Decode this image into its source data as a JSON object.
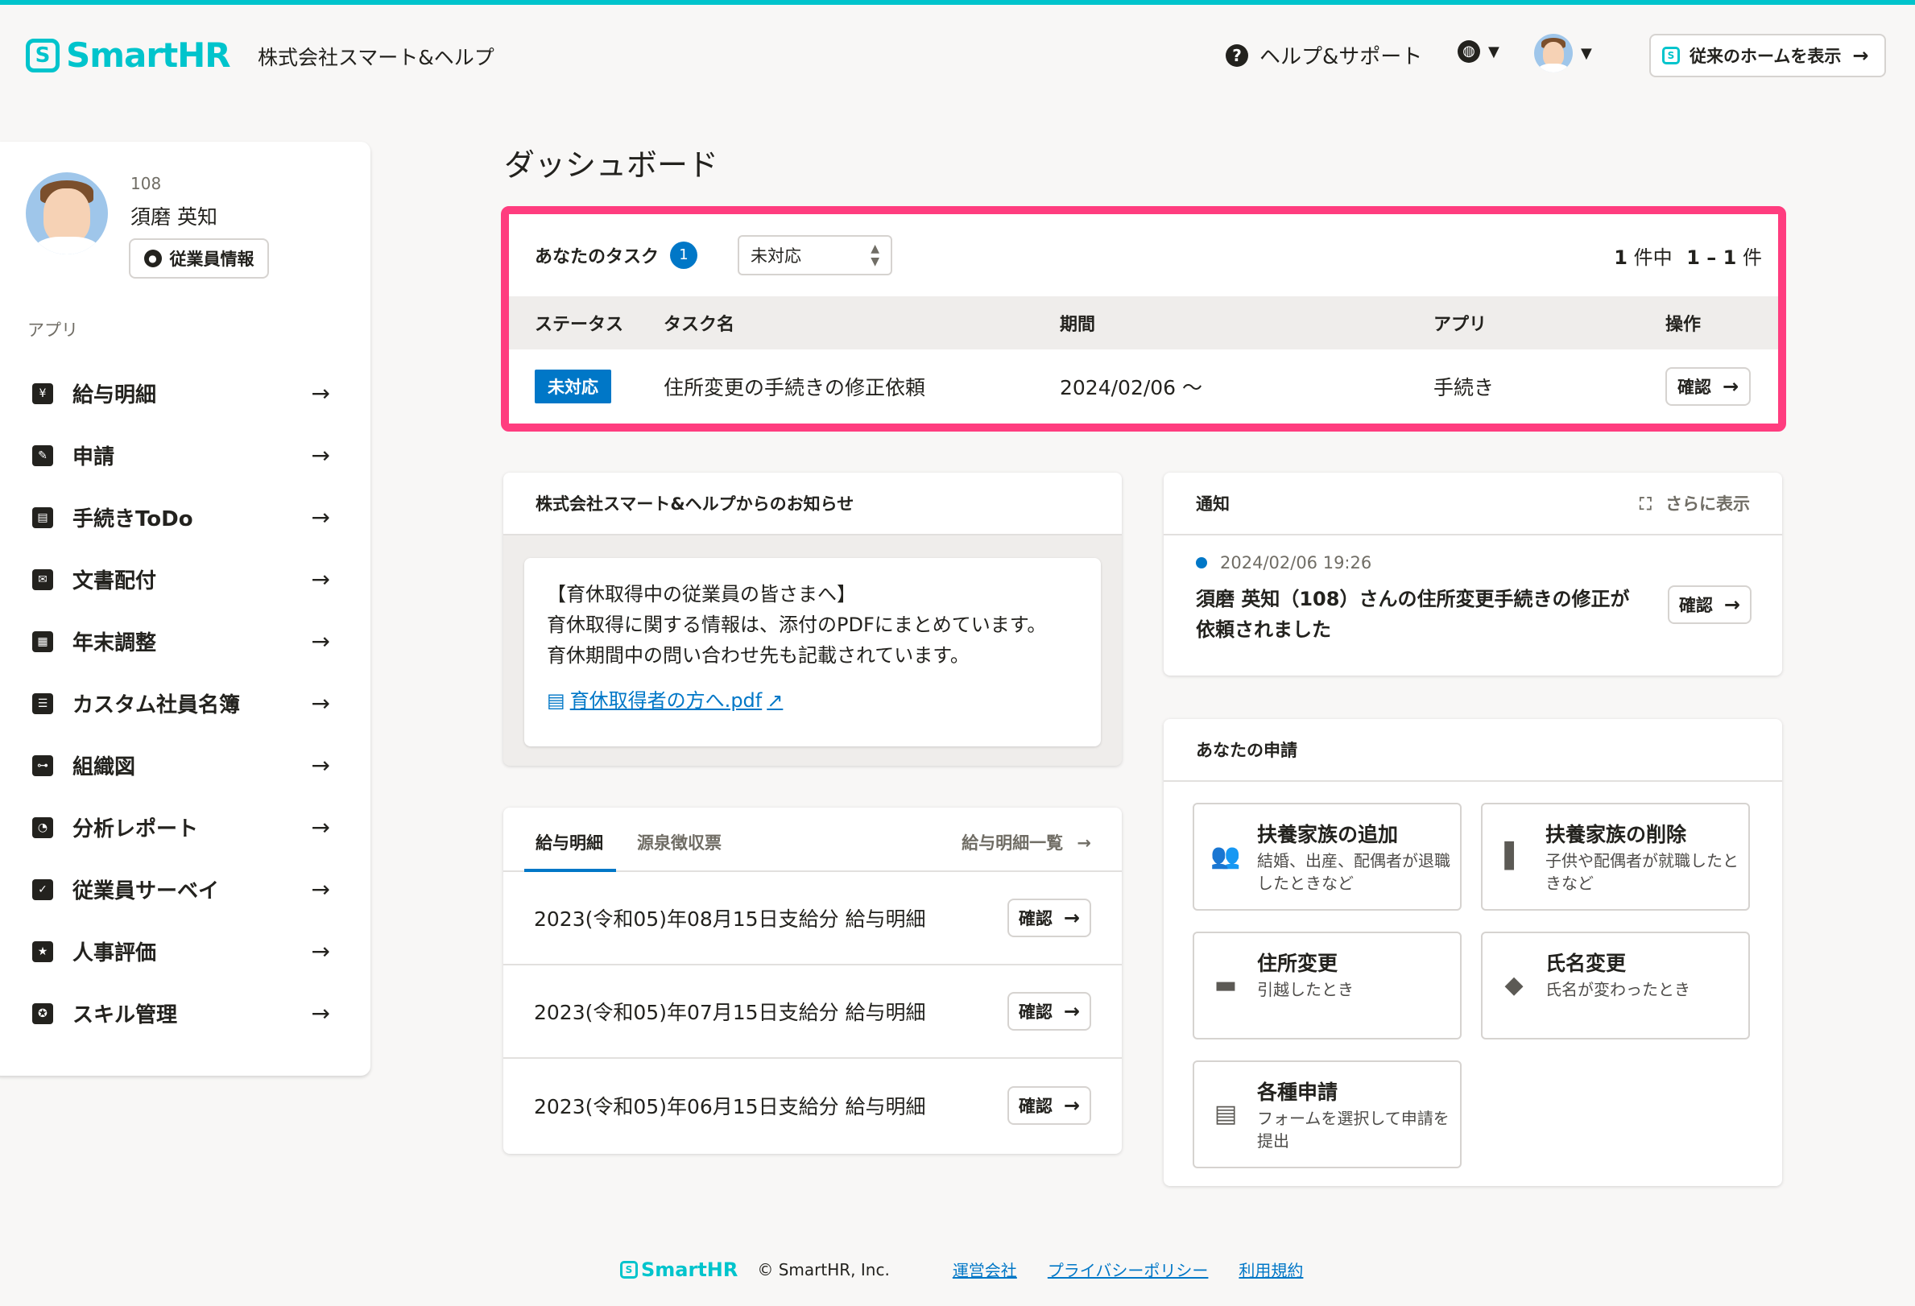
{
  "header": {
    "logo_text": "SmartHR",
    "company": "株式会社スマート&ヘルプ",
    "help": "ヘルプ&サポート",
    "old_home": "従来のホームを表示"
  },
  "sidebar": {
    "employee_no": "108",
    "employee_name": "須磨 英知",
    "employee_info_button": "従業員情報",
    "apps_label": "アプリ",
    "items": [
      {
        "label": "給与明細",
        "icon": "payslip-icon"
      },
      {
        "label": "申請",
        "icon": "application-icon"
      },
      {
        "label": "手続きToDo",
        "icon": "document-icon"
      },
      {
        "label": "文書配付",
        "icon": "inbox-icon"
      },
      {
        "label": "年末調整",
        "icon": "calendar-icon"
      },
      {
        "label": "カスタム社員名簿",
        "icon": "contact-card-icon"
      },
      {
        "label": "組織図",
        "icon": "org-chart-icon"
      },
      {
        "label": "分析レポート",
        "icon": "pie-chart-icon"
      },
      {
        "label": "従業員サーベイ",
        "icon": "clipboard-icon"
      },
      {
        "label": "人事評価",
        "icon": "evaluation-icon"
      },
      {
        "label": "スキル管理",
        "icon": "badge-icon"
      }
    ]
  },
  "main": {
    "title": "ダッシュボード",
    "tasks": {
      "title": "あなたのタスク",
      "count": "1",
      "filter_value": "未対応",
      "paging_total": "1",
      "paging_mid": "件中",
      "paging_range": "1 – 1",
      "paging_unit": "件",
      "columns": [
        "ステータス",
        "タスク名",
        "期間",
        "アプリ",
        "操作"
      ],
      "rows": [
        {
          "status": "未対応",
          "name": "住所変更の手続きの修正依頼",
          "period": "2024/02/06 〜",
          "app": "手続き",
          "action": "確認"
        }
      ]
    },
    "notice": {
      "title": "株式会社スマート&ヘルプからのお知らせ",
      "line1": "【育休取得中の従業員の皆さまへ】",
      "line2": "育休取得に関する情報は、添付のPDFにまとめています。",
      "line3": "育休期間中の問い合わせ先も記載されています。",
      "link": "育休取得者の方へ.pdf"
    },
    "payslip": {
      "tab_active": "給与明細",
      "tab_inactive": "源泉徴収票",
      "all_link": "給与明細一覧",
      "rows": [
        {
          "label": "2023(令和05)年08月15日支給分 給与明細",
          "action": "確認"
        },
        {
          "label": "2023(令和05)年07月15日支給分 給与明細",
          "action": "確認"
        },
        {
          "label": "2023(令和05)年06月15日支給分 給与明細",
          "action": "確認"
        }
      ]
    },
    "notifications": {
      "title": "通知",
      "more": "さらに表示",
      "date": "2024/02/06 19:26",
      "text": "須磨 英知（108）さんの住所変更手続きの修正が依頼されました",
      "action": "確認"
    },
    "applications": {
      "title": "あなたの申請",
      "items": [
        {
          "title": "扶養家族の追加",
          "desc": "結婚、出産、配偶者が退職したときなど",
          "icon": "family-icon"
        },
        {
          "title": "扶養家族の削除",
          "desc": "子供や配偶者が就職したときなど",
          "icon": "door-exit-icon"
        },
        {
          "title": "住所変更",
          "desc": "引越したとき",
          "icon": "truck-icon"
        },
        {
          "title": "氏名変更",
          "desc": "氏名が変わったとき",
          "icon": "tag-icon"
        },
        {
          "title": "各種申請",
          "desc": "フォームを選択して申請を提出",
          "icon": "form-icon"
        }
      ]
    }
  },
  "footer": {
    "logo_text": "SmartHR",
    "copyright": "© SmartHR, Inc.",
    "links": [
      "運営会社",
      "プライバシーポリシー",
      "利用規約"
    ]
  },
  "colors": {
    "brand": "#00c4cc",
    "accent": "#0077c7",
    "highlight_border": "#ff3d7f"
  }
}
